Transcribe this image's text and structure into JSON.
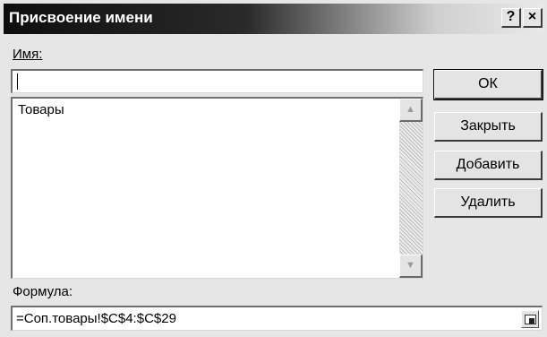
{
  "window": {
    "title": "Присвоение имени",
    "help_label": "?",
    "close_label": "×"
  },
  "name_field": {
    "label": "Имя:",
    "value": ""
  },
  "names_list": {
    "items": [
      "Товары"
    ]
  },
  "buttons": {
    "ok": "ОК",
    "close": "Закрыть",
    "add": "Добавить",
    "delete": "Удалить"
  },
  "formula_field": {
    "label": "Формула:",
    "value": "=Соп.товары!$C$4:$C$29"
  },
  "icons": {
    "scroll_up": "triangle-up",
    "scroll_down": "triangle-down",
    "collapse_dialog": "range-select-icon"
  }
}
